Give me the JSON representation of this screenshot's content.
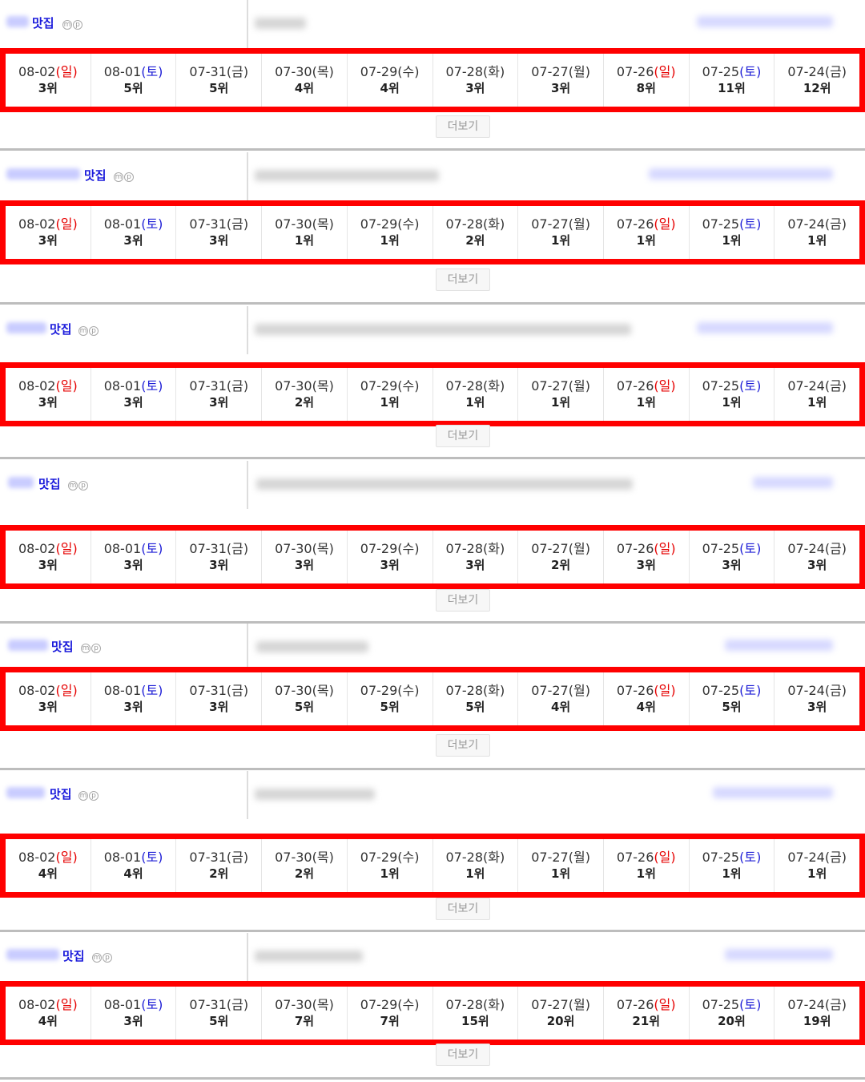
{
  "colors": {
    "highlight": "#ff0000",
    "sunday": "#e60000",
    "saturday": "#1f1fd6",
    "keyword": "#1a1adb"
  },
  "common": {
    "keyword_label": "맛집",
    "mobile_badge": "m",
    "pc_badge": "p",
    "more_label": "더보기",
    "dates": [
      {
        "date": "08-02",
        "day": "일",
        "kind": "sun"
      },
      {
        "date": "08-01",
        "day": "토",
        "kind": "sat"
      },
      {
        "date": "07-31",
        "day": "금",
        "kind": "wk"
      },
      {
        "date": "07-30",
        "day": "목",
        "kind": "wk"
      },
      {
        "date": "07-29",
        "day": "수",
        "kind": "wk"
      },
      {
        "date": "07-28",
        "day": "화",
        "kind": "wk"
      },
      {
        "date": "07-27",
        "day": "월",
        "kind": "wk"
      },
      {
        "date": "07-26",
        "day": "일",
        "kind": "sun"
      },
      {
        "date": "07-25",
        "day": "토",
        "kind": "sat"
      },
      {
        "date": "07-24",
        "day": "금",
        "kind": "wk"
      }
    ]
  },
  "blocks": [
    {
      "ranks": [
        "3위",
        "5위",
        "5위",
        "4위",
        "4위",
        "3위",
        "3위",
        "8위",
        "11위",
        "12위"
      ]
    },
    {
      "ranks": [
        "3위",
        "3위",
        "3위",
        "1위",
        "1위",
        "2위",
        "1위",
        "1위",
        "1위",
        "1위"
      ]
    },
    {
      "ranks": [
        "3위",
        "3위",
        "3위",
        "2위",
        "1위",
        "1위",
        "1위",
        "1위",
        "1위",
        "1위"
      ]
    },
    {
      "ranks": [
        "3위",
        "3위",
        "3위",
        "3위",
        "3위",
        "3위",
        "2위",
        "3위",
        "3위",
        "3위"
      ]
    },
    {
      "ranks": [
        "3위",
        "3위",
        "3위",
        "5위",
        "5위",
        "5위",
        "4위",
        "4위",
        "5위",
        "3위"
      ]
    },
    {
      "ranks": [
        "4위",
        "4위",
        "2위",
        "2위",
        "1위",
        "1위",
        "1위",
        "1위",
        "1위",
        "1위"
      ]
    },
    {
      "ranks": [
        "4위",
        "3위",
        "5위",
        "7위",
        "7위",
        "15위",
        "20위",
        "21위",
        "20위",
        "19위"
      ]
    }
  ]
}
